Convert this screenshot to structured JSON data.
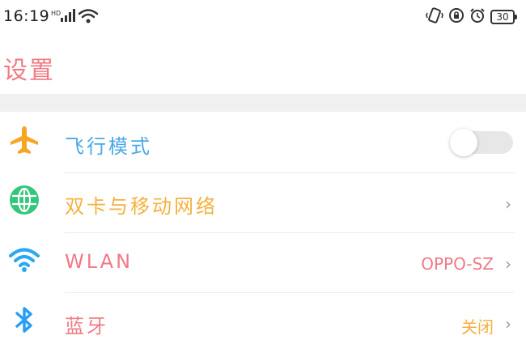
{
  "status_bar": {
    "time": "16:19",
    "battery": "30"
  },
  "header": {
    "title": "设置"
  },
  "settings": {
    "airplane": {
      "label": "飞行模式",
      "label_color": "#4aa8e8",
      "icon_color": "#f5a623"
    },
    "sim": {
      "label": "双卡与移动网络",
      "label_color": "#f5b13d",
      "icon_color": "#34c67a"
    },
    "wlan": {
      "label": "WLAN",
      "value": "OPPO-SZ",
      "label_color": "#f07a86",
      "icon_color": "#2aa8f2"
    },
    "bluetooth": {
      "label": "蓝牙",
      "value": "关闭",
      "label_color": "#f07a86",
      "value_color": "#f5b13d",
      "icon_color": "#2a9df4"
    }
  },
  "chevron": "›"
}
